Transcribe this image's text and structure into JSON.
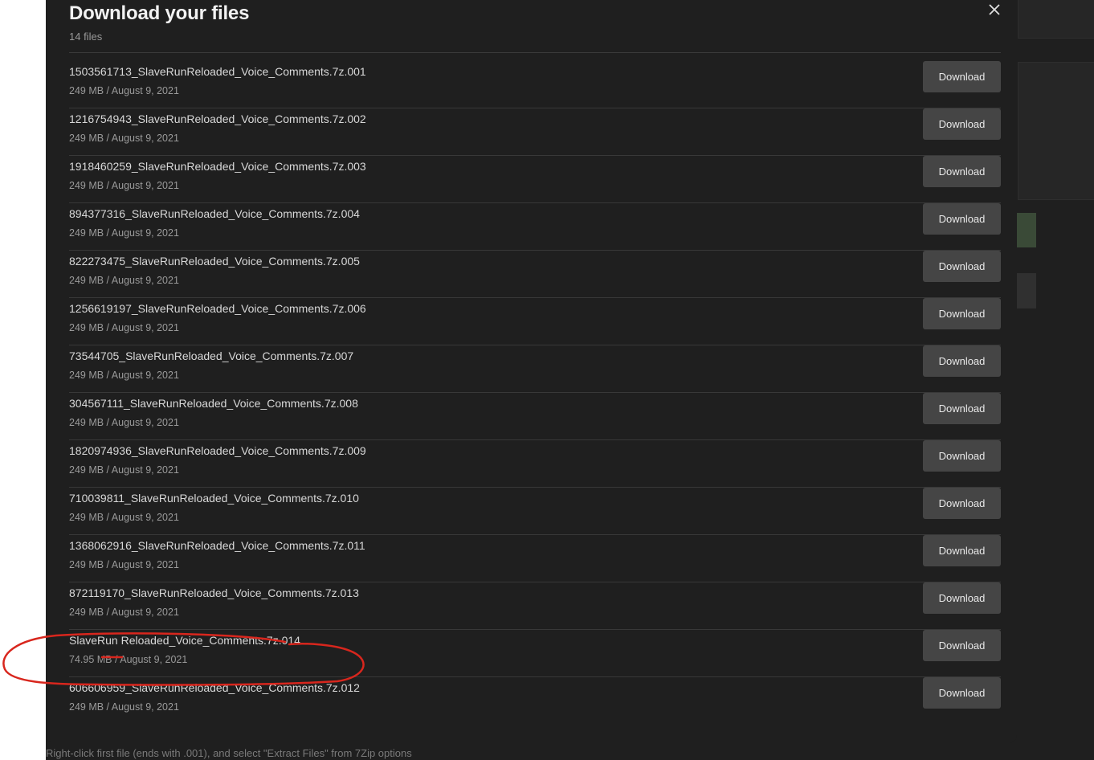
{
  "background": {
    "hint_text": "Right-click first file (ends with .001), and select \"Extract Files\" from 7Zip options"
  },
  "dialog": {
    "title": "Download your files",
    "file_count": "14 files",
    "close_icon": "close-icon",
    "files": [
      {
        "name": "1503561713_SlaveRunReloaded_Voice_Comments.7z.001",
        "meta": "249 MB / August 9, 2021",
        "button": "Download"
      },
      {
        "name": "1216754943_SlaveRunReloaded_Voice_Comments.7z.002",
        "meta": "249 MB / August 9, 2021",
        "button": "Download"
      },
      {
        "name": "1918460259_SlaveRunReloaded_Voice_Comments.7z.003",
        "meta": "249 MB / August 9, 2021",
        "button": "Download"
      },
      {
        "name": "894377316_SlaveRunReloaded_Voice_Comments.7z.004",
        "meta": "249 MB / August 9, 2021",
        "button": "Download"
      },
      {
        "name": "822273475_SlaveRunReloaded_Voice_Comments.7z.005",
        "meta": "249 MB / August 9, 2021",
        "button": "Download"
      },
      {
        "name": "1256619197_SlaveRunReloaded_Voice_Comments.7z.006",
        "meta": "249 MB / August 9, 2021",
        "button": "Download"
      },
      {
        "name": "73544705_SlaveRunReloaded_Voice_Comments.7z.007",
        "meta": "249 MB / August 9, 2021",
        "button": "Download"
      },
      {
        "name": "304567111_SlaveRunReloaded_Voice_Comments.7z.008",
        "meta": "249 MB / August 9, 2021",
        "button": "Download"
      },
      {
        "name": "1820974936_SlaveRunReloaded_Voice_Comments.7z.009",
        "meta": "249 MB / August 9, 2021",
        "button": "Download"
      },
      {
        "name": "710039811_SlaveRunReloaded_Voice_Comments.7z.010",
        "meta": "249 MB / August 9, 2021",
        "button": "Download"
      },
      {
        "name": "1368062916_SlaveRunReloaded_Voice_Comments.7z.011",
        "meta": "249 MB / August 9, 2021",
        "button": "Download"
      },
      {
        "name": "872119170_SlaveRunReloaded_Voice_Comments.7z.013",
        "meta": "249 MB / August 9, 2021",
        "button": "Download"
      },
      {
        "name": "SlaveRun Reloaded_Voice_Comments.7z.014",
        "meta": "74.95 MB / August 9, 2021",
        "button": "Download"
      },
      {
        "name": "606606959_SlaveRunReloaded_Voice_Comments.7z.012",
        "meta": "249 MB / August 9, 2021",
        "button": "Download"
      }
    ]
  },
  "colors": {
    "modal_bg": "#1f1f1f",
    "button_bg": "#454545",
    "annotation_red": "#d8261d"
  }
}
